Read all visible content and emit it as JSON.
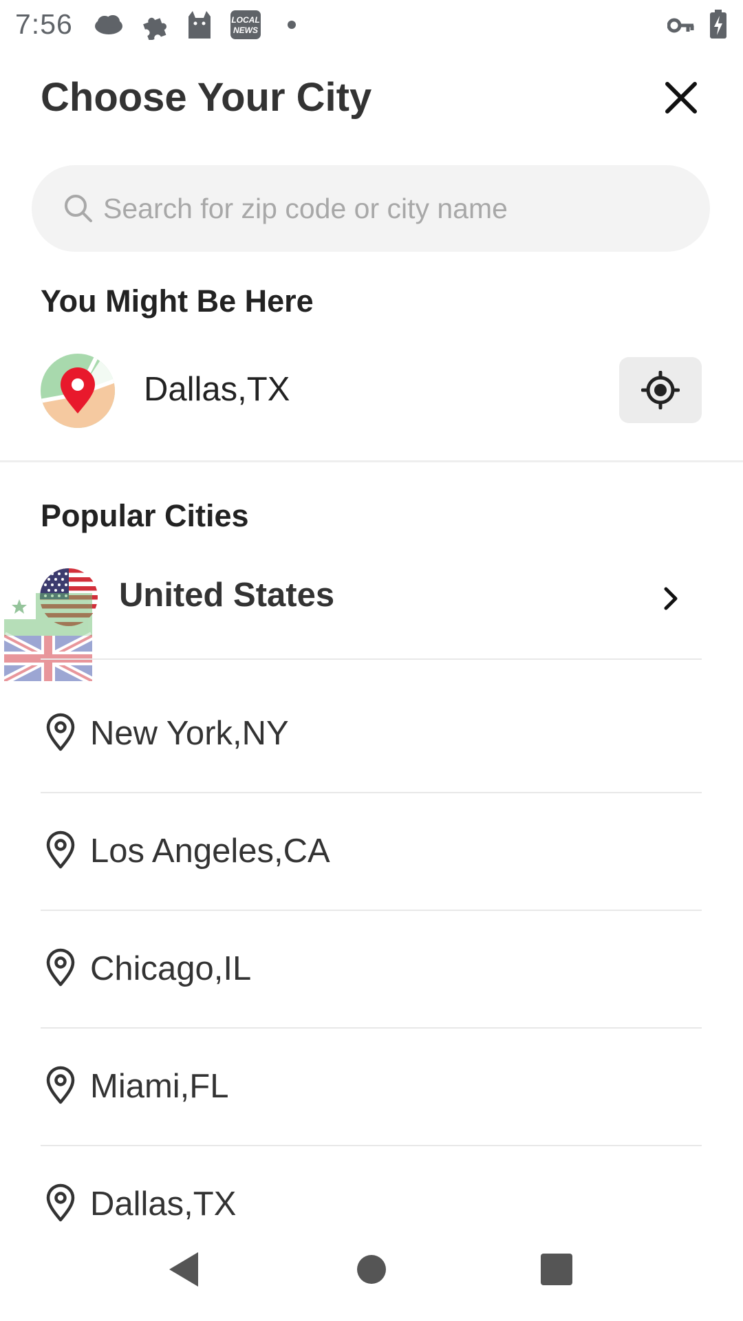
{
  "status_bar": {
    "time": "7:56",
    "icons": [
      "cloud-icon",
      "puzzle-icon",
      "cat-icon",
      "local-news-icon",
      "dot-icon",
      "vpn-key-icon",
      "battery-charging-icon"
    ],
    "news_icon_text": [
      "LOCAL",
      "NEWS"
    ]
  },
  "header": {
    "title": "Choose Your City",
    "close_icon": "close-icon"
  },
  "search": {
    "placeholder": "Search for zip code or city name",
    "value": "",
    "icon": "search-icon"
  },
  "current_location": {
    "section_title": "You Might Be Here",
    "city": "Dallas,TX",
    "avatar_icon": "map-pin-avatar-icon",
    "locate_icon": "gps-locate-icon"
  },
  "popular": {
    "section_title": "Popular Cities",
    "country": {
      "name": "United States",
      "flag_icon": "us-flag-icon",
      "chevron_icon": "chevron-right-icon"
    },
    "cities": [
      {
        "name": "New York,NY"
      },
      {
        "name": "Los Angeles,CA"
      },
      {
        "name": "Chicago,IL"
      },
      {
        "name": "Miami,FL"
      },
      {
        "name": "Dallas,TX"
      }
    ]
  },
  "nav_bar": {
    "buttons": [
      "back-icon",
      "home-icon",
      "recents-icon"
    ]
  },
  "colors": {
    "pin_red": "#e8192c",
    "search_bg": "#f3f3f3",
    "locate_bg": "#ececec",
    "title_text": "#333333"
  }
}
